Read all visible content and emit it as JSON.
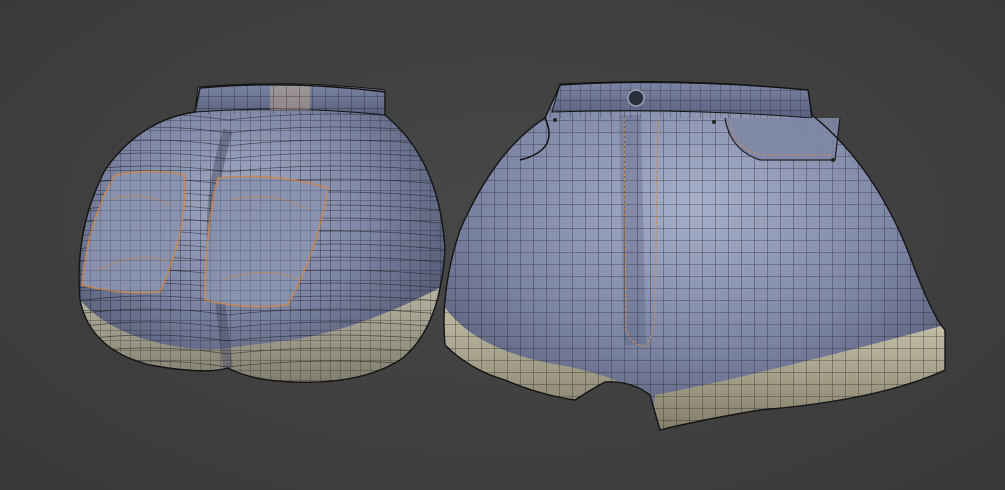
{
  "scene": {
    "subject": "denim-shorts-wireframe",
    "colors": {
      "background": "#3f3f3f",
      "denim": "#7c85a4",
      "denim_light": "#a3acc6",
      "denim_dark": "#4e5570",
      "cuff": "#b7b39b",
      "cuff_dark": "#7b7763",
      "wire": "#141414",
      "stitch": "#c98a55",
      "button": "#2b2f3a"
    }
  }
}
